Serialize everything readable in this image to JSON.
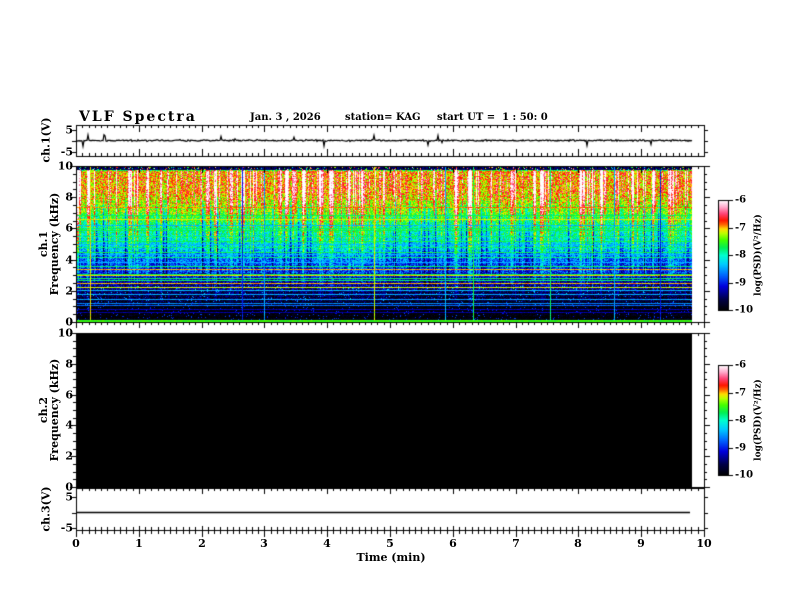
{
  "figure": {
    "title": "VLF Spectra",
    "date": "Jan. 3 , 2026",
    "station": "station= KAG",
    "start_ut": "start UT =  1 : 50: 0"
  },
  "axes": {
    "x": {
      "label": "Time (min)",
      "range_min": [
        0,
        10
      ],
      "major_ticks": [
        0,
        1,
        2,
        3,
        4,
        5,
        6,
        7,
        8,
        9,
        10
      ],
      "minor_step_min": 0.1
    },
    "ch1_volt": {
      "label": "ch.1(V)",
      "range_volt": [
        -5,
        5
      ],
      "ticks": [
        5,
        -5
      ]
    },
    "ch1_freq": {
      "label_lines": [
        "ch.1",
        "Frequency (kHz)"
      ],
      "range_khz": [
        0,
        10
      ],
      "ticks": [
        10,
        8,
        6,
        4,
        2,
        0
      ],
      "minor_step_khz": 0.5
    },
    "ch2_freq": {
      "label_lines": [
        "ch.2",
        "Frequency (kHz)"
      ],
      "range_khz": [
        0,
        10
      ],
      "ticks": [
        10,
        8,
        6,
        4,
        2,
        0
      ],
      "minor_step_khz": 0.5
    },
    "ch3_volt": {
      "label": "ch.3(V)",
      "range_volt": [
        -5,
        5
      ],
      "ticks": [
        5,
        -5
      ]
    }
  },
  "colorbars": [
    {
      "label": "log(PSD)(V²/Hz)",
      "ticks": [
        -6,
        -7,
        -8,
        -9,
        -10
      ],
      "range": [
        -10,
        -6
      ]
    },
    {
      "label": "log(PSD)(V²/Hz)",
      "ticks": [
        -6,
        -7,
        -8,
        -9,
        -10
      ],
      "range": [
        -10,
        -6
      ]
    }
  ],
  "chart_data": [
    {
      "id": "ch1_waveform",
      "type": "line",
      "x_range_min": [
        0,
        9.8
      ],
      "y_range_volt": [
        -5,
        5
      ],
      "mean_volt": 0,
      "noise_amp_volt": 0.25,
      "max_spike_volt": 2.8,
      "description": "quasi-flat trace at 0 V with sporadic small impulses"
    },
    {
      "id": "ch1_spectrogram",
      "type": "heatmap",
      "x_range_min": [
        0,
        9.8
      ],
      "y_range_khz": [
        0,
        10
      ],
      "z_log_psd_range": [
        -10,
        -6
      ],
      "band_profile_khz_logpsd": [
        [
          10,
          -9.6
        ],
        [
          9.78,
          -8.3
        ],
        [
          9.7,
          -7.0
        ],
        [
          9,
          -6.95
        ],
        [
          8,
          -7.05
        ],
        [
          7,
          -7.5
        ],
        [
          6,
          -7.9
        ],
        [
          5,
          -8.15
        ],
        [
          4,
          -8.75
        ],
        [
          3,
          -9.05
        ],
        [
          2.3,
          -9.4
        ],
        [
          1.8,
          -9.6
        ],
        [
          1.2,
          -9.8
        ],
        [
          0.7,
          -9.95
        ],
        [
          0,
          -10
        ]
      ],
      "streak_gain_khz": [
        [
          10,
          0.3
        ],
        [
          9.75,
          1.7
        ],
        [
          7.5,
          1.6
        ],
        [
          6,
          1.3
        ],
        [
          4.5,
          0.9
        ],
        [
          3,
          0.5
        ],
        [
          2,
          0.28
        ],
        [
          1,
          0.12
        ],
        [
          0,
          0.05
        ]
      ],
      "dark_gap_gain_khz": [
        [
          10,
          0
        ],
        [
          8,
          0.3
        ],
        [
          7,
          0.9
        ],
        [
          6,
          1
        ],
        [
          4.5,
          1
        ],
        [
          3.5,
          0.6
        ],
        [
          2.5,
          0.3
        ],
        [
          0,
          0
        ]
      ],
      "horizontal_lines": [
        {
          "f": 7.35,
          "v": -6.9
        },
        {
          "f": 6.85,
          "v": -7.7
        },
        {
          "f": 6.55,
          "v": -7.15
        },
        {
          "f": 6.2,
          "v": -8.4
        },
        {
          "f": 6.0,
          "v": -7.75
        },
        {
          "f": 5.85,
          "v": -7.7
        },
        {
          "f": 5.5,
          "v": -7.8
        },
        {
          "f": 5.15,
          "v": -7.7
        },
        {
          "f": 5.0,
          "v": -8.4
        },
        {
          "f": 4.8,
          "v": -7.8
        },
        {
          "f": 4.45,
          "v": -7.7
        },
        {
          "f": 4.3,
          "v": -8.4
        },
        {
          "f": 4.1,
          "v": -7.8
        },
        {
          "f": 3.8,
          "v": -8.4
        },
        {
          "f": 3.55,
          "v": -7.75
        },
        {
          "f": 3.35,
          "v": -7.0
        },
        {
          "f": 3.05,
          "v": -7.7
        },
        {
          "f": 2.95,
          "v": -7.05
        },
        {
          "f": 2.75,
          "v": -7.7
        },
        {
          "f": 2.65,
          "v": -7.75
        },
        {
          "f": 2.45,
          "v": -7.0
        },
        {
          "f": 2.2,
          "v": -7.15
        },
        {
          "f": 2.0,
          "v": -8.4
        },
        {
          "f": 1.75,
          "v": -8.45
        },
        {
          "f": 1.45,
          "v": -8.5
        },
        {
          "f": 1.15,
          "v": -8.6
        },
        {
          "f": 1.05,
          "v": -8.7
        },
        {
          "f": 0.8,
          "v": -9.25
        },
        {
          "f": 0.6,
          "v": -9.3
        }
      ],
      "vertical_lines": [
        {
          "t_frac": 0.022,
          "v": -7.1
        },
        {
          "t_frac": 0.27,
          "v": -9.0
        },
        {
          "t_frac": 0.305,
          "v": -8.5
        },
        {
          "t_frac": 0.484,
          "v": -7.15
        },
        {
          "t_frac": 0.6,
          "v": -8.4
        },
        {
          "t_frac": 0.645,
          "v": -7.7
        },
        {
          "t_frac": 0.77,
          "v": -7.75
        },
        {
          "t_frac": 0.875,
          "v": -8.45
        },
        {
          "t_frac": 0.95,
          "v": -9.0
        }
      ],
      "bottom_edge_line": {
        "f": 0.05,
        "v": -7.5
      },
      "colormap_stops": [
        [
          0.0,
          "#000000"
        ],
        [
          0.1,
          "#000046"
        ],
        [
          0.22,
          "#0000dd"
        ],
        [
          0.32,
          "#0066ff"
        ],
        [
          0.42,
          "#00ccff"
        ],
        [
          0.5,
          "#00ffd0"
        ],
        [
          0.57,
          "#00ee55"
        ],
        [
          0.64,
          "#44ff00"
        ],
        [
          0.7,
          "#bbff00"
        ],
        [
          0.74,
          "#ffdd00"
        ],
        [
          0.78,
          "#ff6600"
        ],
        [
          0.82,
          "#ff1500"
        ],
        [
          0.88,
          "#ff4477"
        ],
        [
          0.94,
          "#ffaacc"
        ],
        [
          1.0,
          "#ffffff"
        ]
      ]
    },
    {
      "id": "ch2_spectrogram",
      "type": "heatmap",
      "x_range_min": [
        0,
        9.8
      ],
      "y_range_khz": [
        0,
        10
      ],
      "z_log_psd_range": [
        -10,
        -6
      ],
      "values": "no data — uniform minimum (solid black)",
      "fill_log_psd": -10
    },
    {
      "id": "ch3_waveform",
      "type": "line",
      "x_range_min": [
        0,
        9.8
      ],
      "y_range_volt": [
        -5,
        5
      ],
      "constant_volt": 0,
      "description": "perfectly flat trace at 0 V"
    }
  ]
}
